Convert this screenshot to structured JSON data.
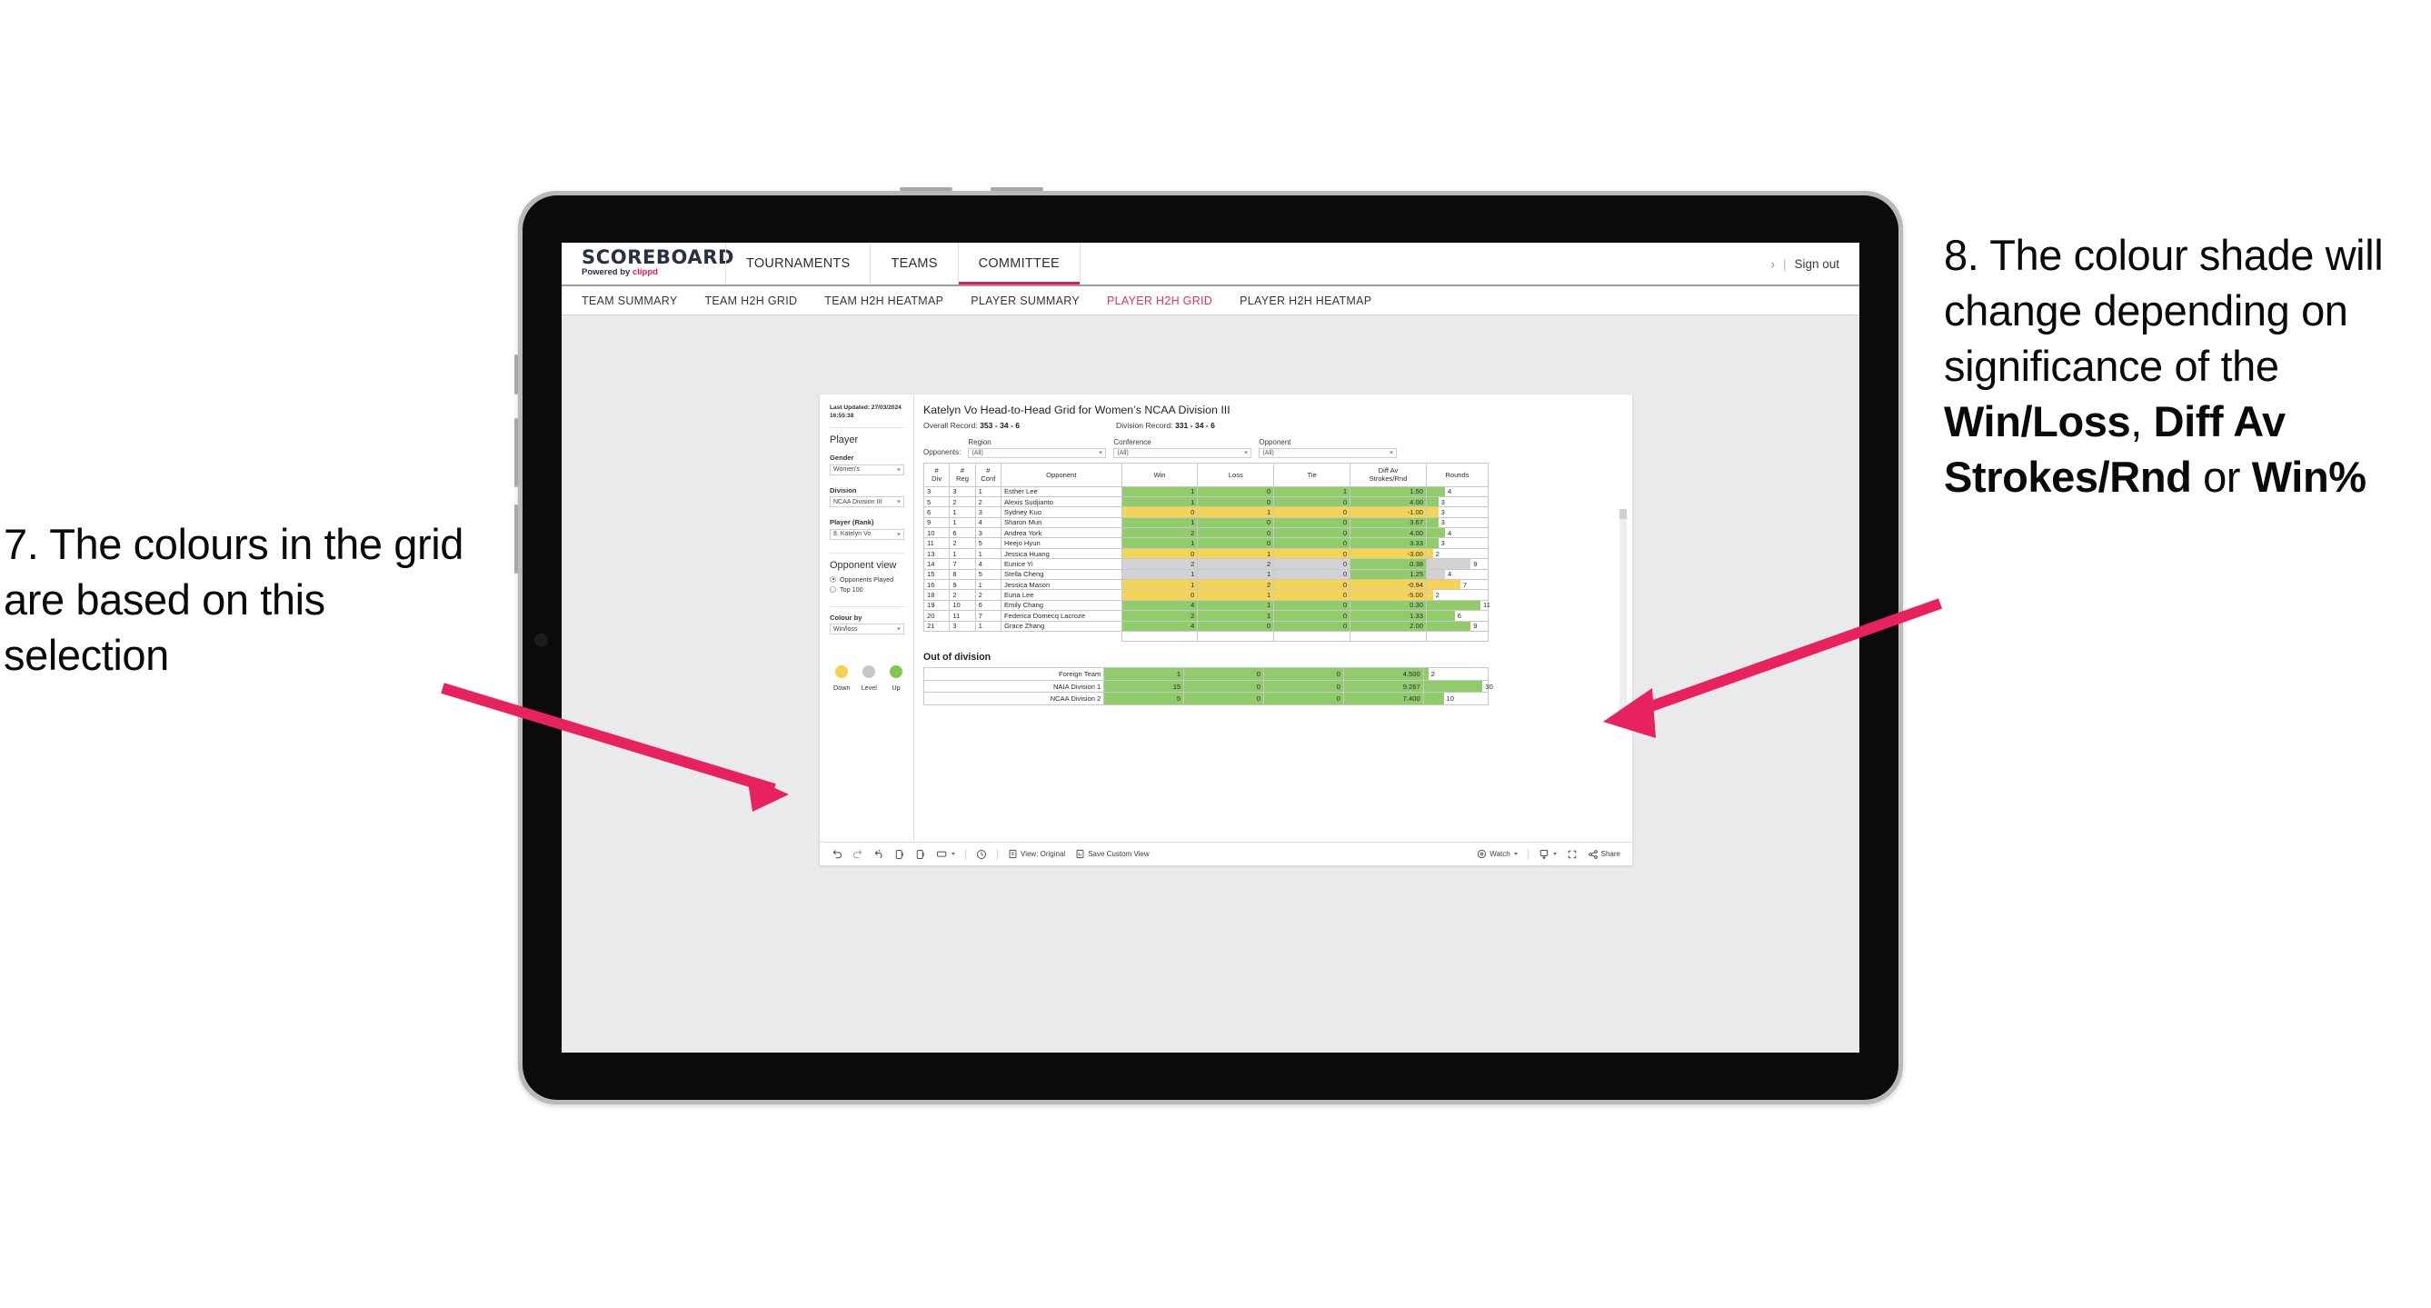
{
  "annotations": {
    "left": "7. The colours in the grid are based on this selection",
    "right_parts": [
      {
        "text": "8. The colour shade will change depending on significance of the ",
        "bold": false
      },
      {
        "text": "Win/Loss",
        "bold": true
      },
      {
        "text": ", ",
        "bold": false
      },
      {
        "text": "Diff Av Strokes/Rnd",
        "bold": true
      },
      {
        "text": " or ",
        "bold": false
      },
      {
        "text": "Win%",
        "bold": true
      }
    ],
    "arrow_color": "#e8225e"
  },
  "app": {
    "logo": {
      "main": "SCOREBOARD",
      "powered_prefix": "Powered by ",
      "brand": "clippd"
    },
    "top_nav": [
      {
        "label": "TOURNAMENTS",
        "active": false
      },
      {
        "label": "TEAMS",
        "active": false
      },
      {
        "label": "COMMITTEE",
        "active": true
      }
    ],
    "sign_out": "Sign out",
    "sub_nav": [
      {
        "label": "TEAM SUMMARY",
        "active": false
      },
      {
        "label": "TEAM H2H GRID",
        "active": false
      },
      {
        "label": "TEAM H2H HEATMAP",
        "active": false
      },
      {
        "label": "PLAYER SUMMARY",
        "active": false
      },
      {
        "label": "PLAYER H2H GRID",
        "active": true
      },
      {
        "label": "PLAYER H2H HEATMAP",
        "active": false
      }
    ]
  },
  "filters": {
    "last_updated": "Last Updated: 27/03/2024 16:55:38",
    "player_heading": "Player",
    "gender_label": "Gender",
    "gender_value": "Women’s",
    "division_label": "Division",
    "division_value": "NCAA Division III",
    "player_rank_label": "Player (Rank)",
    "player_rank_value": "8. Katelyn Vo",
    "opponent_view_heading": "Opponent view",
    "opponent_view_options": [
      {
        "label": "Opponents Played",
        "selected": true
      },
      {
        "label": "Top 100",
        "selected": false
      }
    ],
    "colour_by_label": "Colour by",
    "colour_by_value": "Win/loss",
    "legend": [
      {
        "label": "Down",
        "color": "#f6d34a"
      },
      {
        "label": "Level",
        "color": "#c3c7cb"
      },
      {
        "label": "Up",
        "color": "#7ec850"
      }
    ]
  },
  "grid": {
    "title": "Katelyn Vo Head-to-Head Grid for Women’s NCAA Division III",
    "overall_record_label": "Overall Record: ",
    "overall_record_value": "353 -  34 - 6",
    "division_record_label": "Division Record: ",
    "division_record_value": "331 -  34 - 6",
    "opponents_label": "Opponents:",
    "opponent_filters": [
      {
        "caption": "Region",
        "value": "(All)"
      },
      {
        "caption": "Conference",
        "value": "(All)"
      },
      {
        "caption": "Opponent",
        "value": "(All)"
      }
    ],
    "columns": [
      "# Div",
      "# Reg",
      "# Conf",
      "Opponent",
      "Win",
      "Loss",
      "Tie",
      "Diff Av Strokes/Rnd",
      "Rounds"
    ],
    "rows": [
      {
        "div": "3",
        "reg": "3",
        "conf": "1",
        "opponent": "Esther Lee",
        "win": "1",
        "loss": "0",
        "tie": "1",
        "diff": "1.50",
        "rounds": "4",
        "state": "up",
        "bar_pct": 30
      },
      {
        "div": "5",
        "reg": "2",
        "conf": "2",
        "opponent": "Alexis Sudjianto",
        "win": "1",
        "loss": "0",
        "tie": "0",
        "diff": "4.00",
        "rounds": "3",
        "state": "up",
        "bar_pct": 19
      },
      {
        "div": "6",
        "reg": "1",
        "conf": "3",
        "opponent": "Sydney Kuo",
        "win": "0",
        "loss": "1",
        "tie": "0",
        "diff": "-1.00",
        "rounds": "3",
        "state": "down",
        "bar_pct": 19
      },
      {
        "div": "9",
        "reg": "1",
        "conf": "4",
        "opponent": "Sharon Mun",
        "win": "1",
        "loss": "0",
        "tie": "0",
        "diff": "3.67",
        "rounds": "3",
        "state": "up",
        "bar_pct": 19
      },
      {
        "div": "10",
        "reg": "6",
        "conf": "3",
        "opponent": "Andrea York",
        "win": "2",
        "loss": "0",
        "tie": "0",
        "diff": "4.00",
        "rounds": "4",
        "state": "up",
        "bar_pct": 30
      },
      {
        "div": "11",
        "reg": "2",
        "conf": "5",
        "opponent": "Heejo Hyun",
        "win": "1",
        "loss": "0",
        "tie": "0",
        "diff": "3.33",
        "rounds": "3",
        "state": "up",
        "bar_pct": 19
      },
      {
        "div": "13",
        "reg": "1",
        "conf": "1",
        "opponent": "Jessica Huang",
        "win": "0",
        "loss": "1",
        "tie": "0",
        "diff": "-3.00",
        "rounds": "2",
        "state": "down",
        "bar_pct": 10
      },
      {
        "div": "14",
        "reg": "7",
        "conf": "4",
        "opponent": "Eunice Yi",
        "win": "2",
        "loss": "2",
        "tie": "0",
        "diff": "0.38",
        "rounds": "9",
        "state": "level",
        "bar_pct": 72
      },
      {
        "div": "15",
        "reg": "8",
        "conf": "5",
        "opponent": "Stella Cheng",
        "win": "1",
        "loss": "1",
        "tie": "0",
        "diff": "1.25",
        "rounds": "4",
        "state": "level",
        "bar_pct": 30
      },
      {
        "div": "16",
        "reg": "9",
        "conf": "1",
        "opponent": "Jessica Mason",
        "win": "1",
        "loss": "2",
        "tie": "0",
        "diff": "-0.94",
        "rounds": "7",
        "state": "down",
        "bar_pct": 55
      },
      {
        "div": "18",
        "reg": "2",
        "conf": "2",
        "opponent": "Euna Lee",
        "win": "0",
        "loss": "1",
        "tie": "0",
        "diff": "-5.00",
        "rounds": "2",
        "state": "down",
        "bar_pct": 10
      },
      {
        "div": "19",
        "reg": "10",
        "conf": "6",
        "opponent": "Emily Chang",
        "win": "4",
        "loss": "1",
        "tie": "0",
        "diff": "0.30",
        "rounds": "11",
        "state": "up",
        "bar_pct": 88
      },
      {
        "div": "20",
        "reg": "11",
        "conf": "7",
        "opponent": "Federica Domecq Lacroze",
        "win": "2",
        "loss": "1",
        "tie": "0",
        "diff": "1.33",
        "rounds": "6",
        "state": "up",
        "bar_pct": 46
      }
    ],
    "clipped_row": {
      "div": "21",
      "reg": "3",
      "conf": "1",
      "opponent": "Grace Zhang",
      "win": "4",
      "loss": "0",
      "tie": "0",
      "diff": "2.00",
      "rounds": "9",
      "state": "up",
      "bar_pct": 72
    },
    "out_of_division_title": "Out of division",
    "out_of_division_rows": [
      {
        "name": "Foreign Team",
        "win": "1",
        "loss": "0",
        "tie": "0",
        "diff": "4.500",
        "rounds": "2",
        "state": "up",
        "bar_pct": 7
      },
      {
        "name": "NAIA Division 1",
        "win": "15",
        "loss": "0",
        "tie": "0",
        "diff": "9.267",
        "rounds": "30",
        "state": "up",
        "bar_pct": 92
      },
      {
        "name": "NCAA Division 2",
        "win": "5",
        "loss": "0",
        "tie": "0",
        "diff": "7.400",
        "rounds": "10",
        "state": "up",
        "bar_pct": 31
      }
    ]
  },
  "toolbar": {
    "view_label": "View: Original",
    "save_label": "Save Custom View",
    "watch_label": "Watch",
    "share_label": "Share"
  },
  "colors": {
    "up": "#90cd6a",
    "down": "#f4d355",
    "level": "#d2d2d4",
    "accent": "#e0315f"
  }
}
